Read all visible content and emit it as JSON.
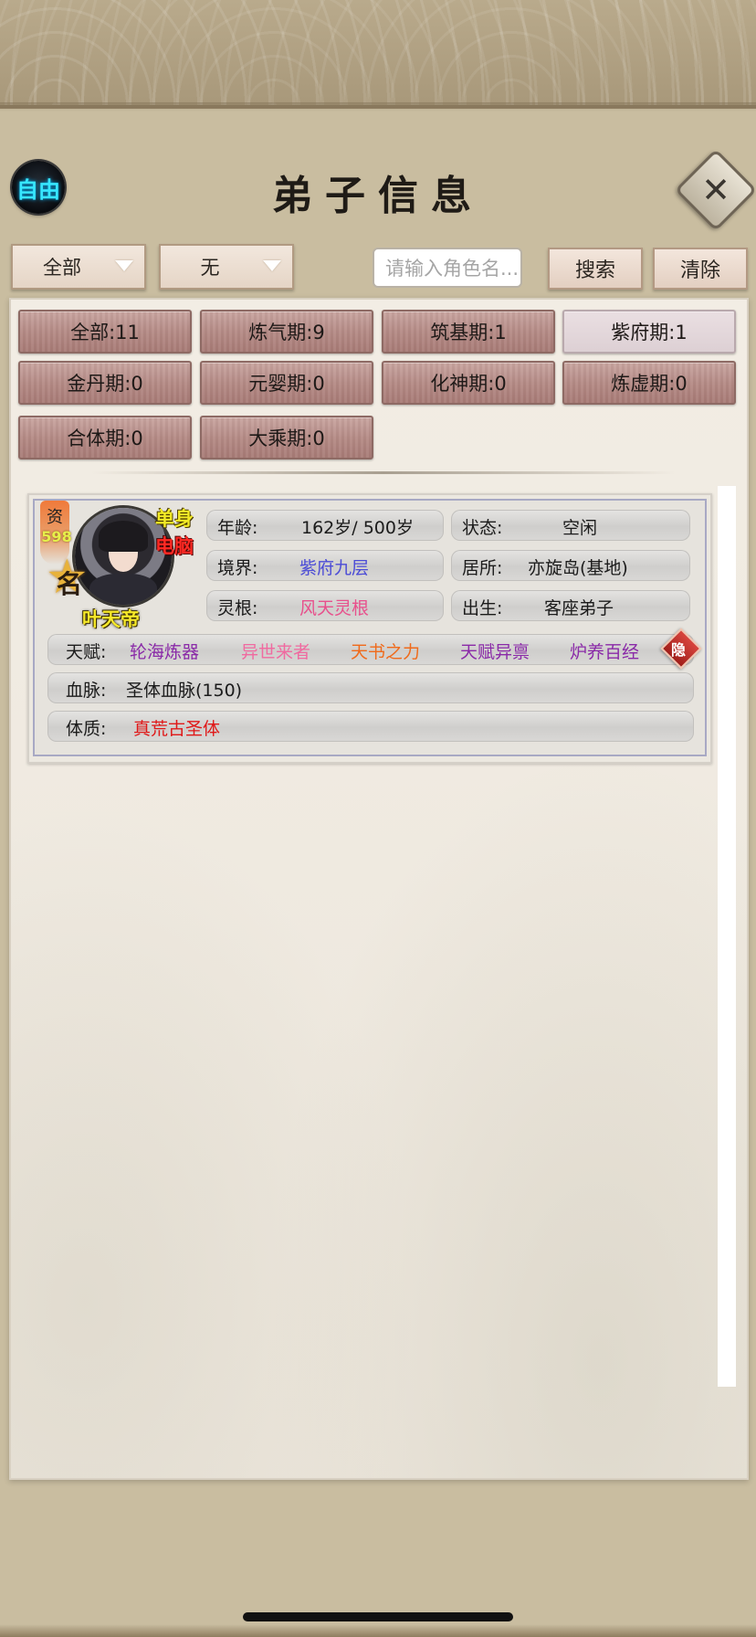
{
  "header": {
    "free_badge": "自由",
    "title": "弟子信息",
    "close_icon": "close-icon"
  },
  "toolbar": {
    "dropdown1": "全部",
    "dropdown2": "无",
    "search_placeholder": "请输入角色名...",
    "search_label": "搜索",
    "clear_label": "清除"
  },
  "filters": [
    {
      "label": "全部:11",
      "selected": false
    },
    {
      "label": "炼气期:9",
      "selected": false
    },
    {
      "label": "筑基期:1",
      "selected": false
    },
    {
      "label": "紫府期:1",
      "selected": true
    },
    {
      "label": "金丹期:0",
      "selected": false
    },
    {
      "label": "元婴期:0",
      "selected": false
    },
    {
      "label": "化神期:0",
      "selected": false
    },
    {
      "label": "炼虚期:0",
      "selected": false
    },
    {
      "label": "合体期:0",
      "selected": false
    },
    {
      "label": "大乘期:0",
      "selected": false
    }
  ],
  "disciple": {
    "zi_label": "资",
    "zi_value": "598",
    "ming": "名",
    "single": "单身",
    "computer": "电脑",
    "name": "叶天帝",
    "age_label": "年龄:",
    "age_value": "162岁/ 500岁",
    "status_label": "状态:",
    "status_value": "空闲",
    "realm_label": "境界:",
    "realm_value": "紫府九层",
    "residence_label": "居所:",
    "residence_value": "亦旋岛(基地)",
    "root_label": "灵根:",
    "root_value": "风天灵根",
    "origin_label": "出生:",
    "origin_value": "客座弟子",
    "talent_label": "天赋:",
    "talents": [
      "轮海炼器",
      "异世来者",
      "天书之力",
      "天赋异禀",
      "炉养百经"
    ],
    "hide_label": "隐",
    "bloodline_label": "血脉:",
    "bloodline_value": "圣体血脉(150)",
    "physique_label": "体质:",
    "physique_value": "真荒古圣体"
  },
  "colors": {
    "realm": "#4b4bd6",
    "root": "#e8508c",
    "talent1": "#8a2aa8",
    "talent2": "#f06aa0",
    "talent3": "#f06a1a",
    "talent4": "#8a2aa8",
    "talent5": "#8a2aa8",
    "physique": "#e01818"
  }
}
